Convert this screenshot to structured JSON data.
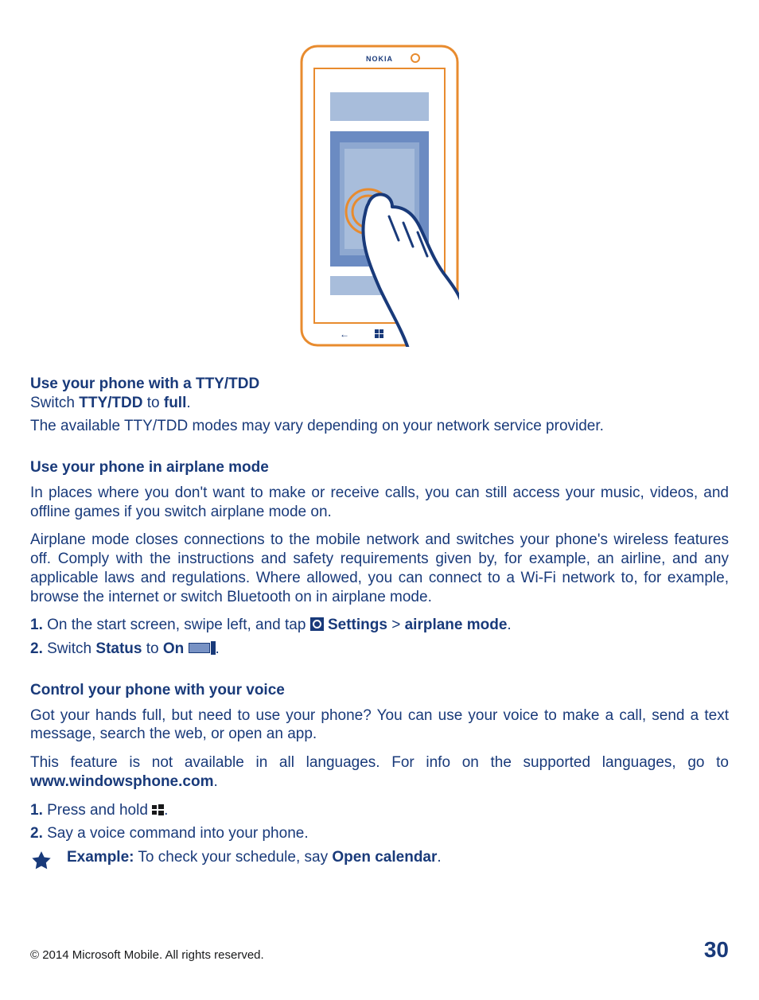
{
  "illustration": {
    "brand": "NOKIA",
    "back_arrow": "←"
  },
  "s1": {
    "title": "Use your phone with a TTY/TDD",
    "l1a": "Switch ",
    "l1b": "TTY/TDD",
    "l1c": " to ",
    "l1d": "full",
    "l1e": ".",
    "l2": "The available TTY/TDD modes may vary depending on your network service provider."
  },
  "s2": {
    "title": "Use your phone in airplane mode",
    "p1": "In places where you don't want to make or receive calls, you can still access your music, videos, and offline games if you switch airplane mode on.",
    "p2": "Airplane mode closes connections to the mobile network and switches your phone's wireless features off. Comply with the instructions and safety requirements given by, for example, an airline, and any applicable laws and regulations. Where allowed, you can connect to a Wi-Fi network to, for example, browse the internet or switch Bluetooth on in airplane mode.",
    "step1_num": "1.",
    "step1_a": " On the start screen, swipe left, and tap ",
    "step1_b": "Settings",
    "step1_c": " > ",
    "step1_d": "airplane mode",
    "step1_e": ".",
    "step2_num": "2.",
    "step2_a": " Switch ",
    "step2_b": "Status",
    "step2_c": " to ",
    "step2_d": "On",
    "step2_e": "."
  },
  "s3": {
    "title": "Control your phone with your voice",
    "p1": "Got your hands full, but need to use your phone? You can use your voice to make a call, send a text message, search the web, or open an app.",
    "p2a": "This feature is not available in all languages. For info on the supported languages, go to ",
    "p2b": "www.windowsphone.com",
    "p2c": ".",
    "step1_num": "1.",
    "step1_a": " Press and hold ",
    "step1_b": ".",
    "step2_num": "2.",
    "step2_a": " Say a voice command into your phone.",
    "ex_label": "Example:",
    "ex_a": " To check your schedule, say ",
    "ex_b": "Open calendar",
    "ex_c": "."
  },
  "footer": {
    "copyright": "© 2014 Microsoft Mobile. All rights reserved.",
    "page": "30"
  }
}
